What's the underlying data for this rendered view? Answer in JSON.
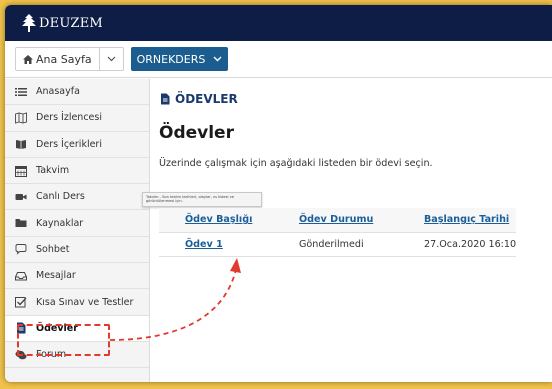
{
  "header": {
    "logo_text": "DEUZEM"
  },
  "navbar": {
    "home_label": "Ana Sayfa",
    "course_label": "ORNEKDERS"
  },
  "sidebar": {
    "items": [
      {
        "label": "Anasayfa",
        "icon": "list-icon",
        "active": false
      },
      {
        "label": "Ders İzlencesi",
        "icon": "map-icon",
        "active": false
      },
      {
        "label": "Ders İçerikleri",
        "icon": "book-icon",
        "active": false
      },
      {
        "label": "Takvim",
        "icon": "calendar-icon",
        "active": false
      },
      {
        "label": "Canlı Ders",
        "icon": "video-icon",
        "active": false
      },
      {
        "label": "Kaynaklar",
        "icon": "folder-icon",
        "active": false
      },
      {
        "label": "Sohbet",
        "icon": "chat-icon",
        "active": false
      },
      {
        "label": "Mesajlar",
        "icon": "inbox-icon",
        "active": false
      },
      {
        "label": "Kısa Sınav ve Testler",
        "icon": "checkbox-icon",
        "active": false
      },
      {
        "label": "Ödevler",
        "icon": "file-icon",
        "active": true
      },
      {
        "label": "Forum",
        "icon": "comments-icon",
        "active": false
      }
    ]
  },
  "main": {
    "section_title": "ÖDEVLER",
    "page_title": "Ödevler",
    "instruction": "Üzerinde çalışmak için aşağıdaki listeden bir ödevi seçin.",
    "tooltip": "Takvim - Son teslim tarihleri, olaylar, vs listesi ve görüntülenmesi için.",
    "table": {
      "headers": [
        "Ödev Başlığı",
        "Ödev Durumu",
        "Başlangıç Tarihi"
      ],
      "rows": [
        {
          "title": "Ödev 1",
          "status": "Gönderilmedi",
          "start": "27.Oca.2020 16:10"
        }
      ]
    }
  },
  "colors": {
    "topbar": "#0e1d45",
    "course_button": "#1c5d8f",
    "link": "#1a5e9a",
    "annotation": "#e23a2d"
  }
}
